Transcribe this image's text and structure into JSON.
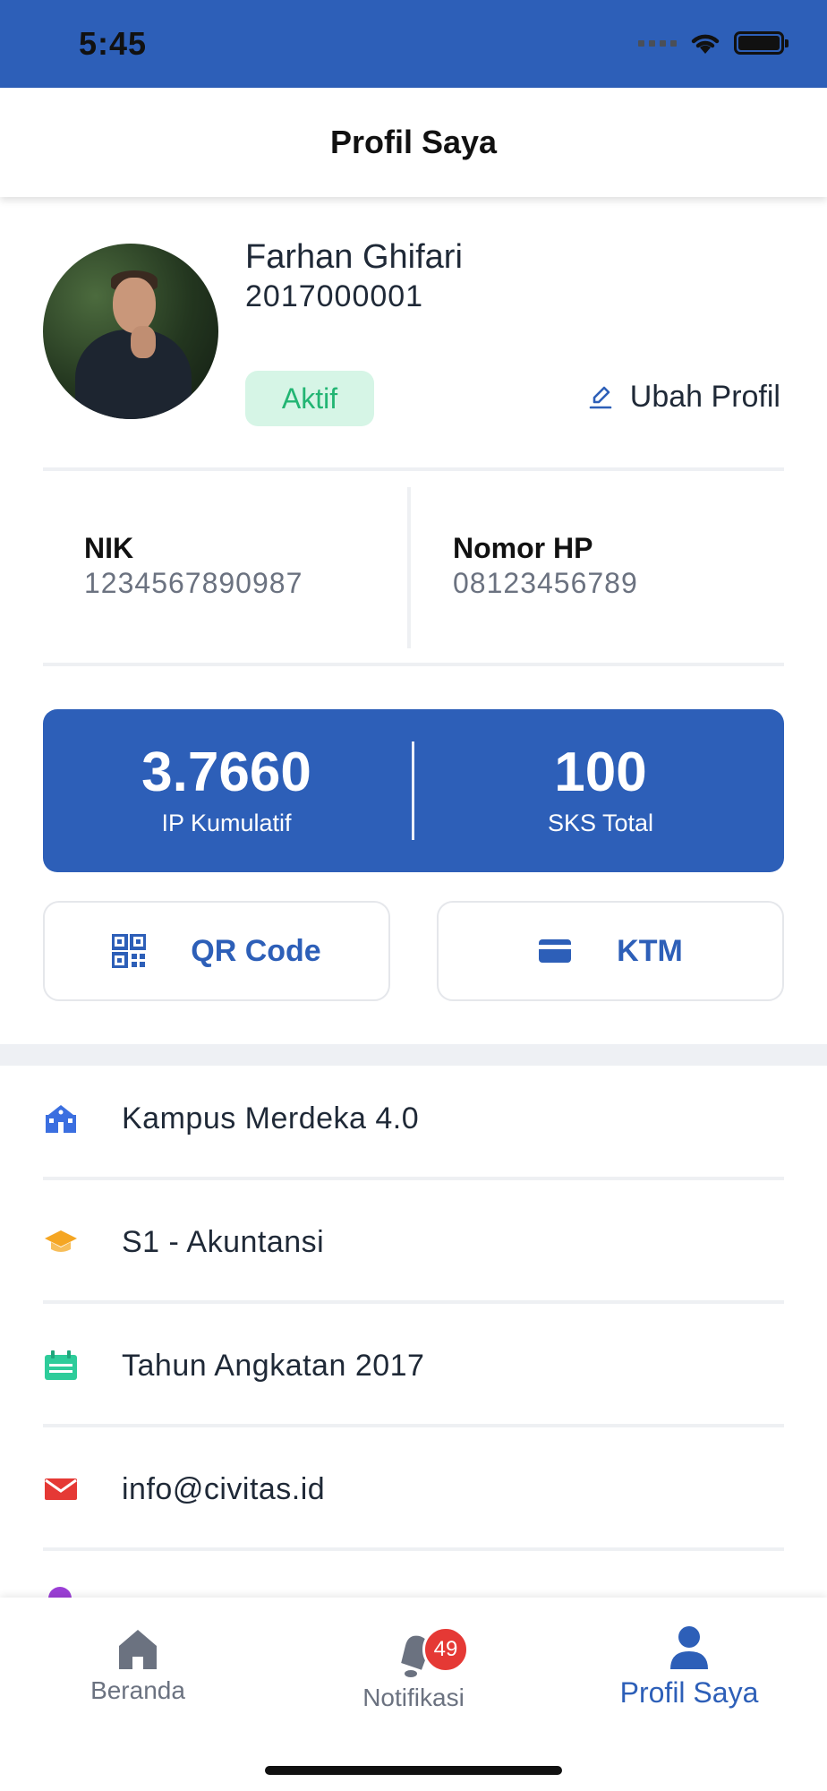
{
  "status_bar": {
    "time": "5:45"
  },
  "header": {
    "title": "Profil Saya"
  },
  "profile": {
    "name": "Farhan Ghifari",
    "id_number": "2017000001",
    "status": "Aktif",
    "edit_label": "Ubah Profil"
  },
  "info": {
    "nik_label": "NIK",
    "nik_value": "1234567890987",
    "phone_label": "Nomor HP",
    "phone_value": "08123456789"
  },
  "stats": {
    "gpa_value": "3.7660",
    "gpa_label": "IP Kumulatif",
    "sks_value": "100",
    "sks_label": "SKS Total"
  },
  "actions": {
    "qr_label": "QR Code",
    "ktm_label": "KTM"
  },
  "list": [
    {
      "label": "Kampus Merdeka 4.0",
      "icon": "school-icon",
      "color": "#3b6fe0"
    },
    {
      "label": "S1 - Akuntansi",
      "icon": "graduation-cap-icon",
      "color": "#f5a623"
    },
    {
      "label": "Tahun Angkatan 2017",
      "icon": "calendar-icon",
      "color": "#2ecc9a"
    },
    {
      "label": "info@civitas.id",
      "icon": "mail-icon",
      "color": "#e53935"
    }
  ],
  "bottom_nav": {
    "home_label": "Beranda",
    "notif_label": "Notifikasi",
    "notif_count": "49",
    "profile_label": "Profil Saya"
  },
  "colors": {
    "primary": "#2d5fb8",
    "active_badge_bg": "#d6f5e6",
    "active_badge_text": "#22b573"
  }
}
